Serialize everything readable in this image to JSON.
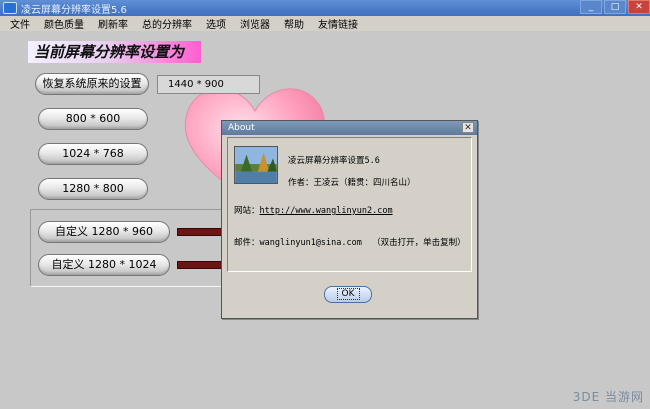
{
  "window": {
    "title": "凌云屏幕分辨率设置5.6"
  },
  "menu": [
    "文件",
    "颜色质量",
    "刷新率",
    "总的分辨率",
    "选项",
    "浏览器",
    "帮助",
    "友情链接"
  ],
  "main": {
    "headline": "当前屏幕分辨率设置为",
    "restore_label": "恢复系统原来的设置",
    "current_resolution": "1440 * 900",
    "presets": [
      "800 * 600",
      "1024 * 768",
      "1280 * 800"
    ],
    "custom": [
      "自定义 1280 * 960",
      "自定义 1280 * 1024"
    ]
  },
  "about": {
    "title": "About",
    "name": "凌云屏幕分辨率设置5.6",
    "author": "作者：王凌云（籍贯：四川名山）",
    "website_label": "网站：",
    "website_url": "http://www.wanglinyun2.com",
    "email_label": "邮件：",
    "email": "wanglinyun1@sina.com",
    "email_hint": "（双击打开，单击复制）",
    "ok_label": "OK"
  },
  "watermark": "3DE 当游网"
}
